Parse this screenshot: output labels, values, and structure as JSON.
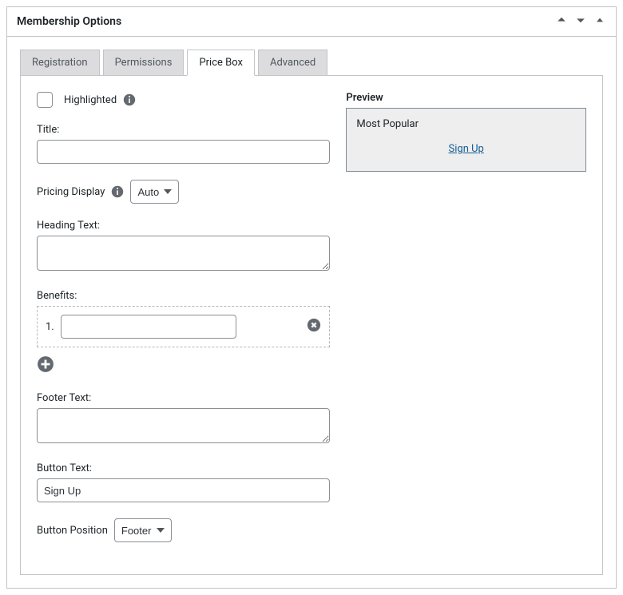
{
  "panel": {
    "title": "Membership Options"
  },
  "tabs": {
    "t0": "Registration",
    "t1": "Permissions",
    "t2": "Price Box",
    "t3": "Advanced"
  },
  "form": {
    "highlighted_label": "Highlighted",
    "title_label": "Title:",
    "title_value": "",
    "pricing_display_label": "Pricing Display",
    "pricing_display_value": "Auto",
    "heading_text_label": "Heading Text:",
    "heading_text_value": "",
    "benefits_label": "Benefits:",
    "benefit_num": "1.",
    "benefit_value": "",
    "footer_text_label": "Footer Text:",
    "footer_text_value": "",
    "button_text_label": "Button Text:",
    "button_text_value": "Sign Up",
    "button_position_label": "Button Position",
    "button_position_value": "Footer"
  },
  "preview": {
    "label": "Preview",
    "badge": "Most Popular",
    "link": "Sign Up"
  }
}
